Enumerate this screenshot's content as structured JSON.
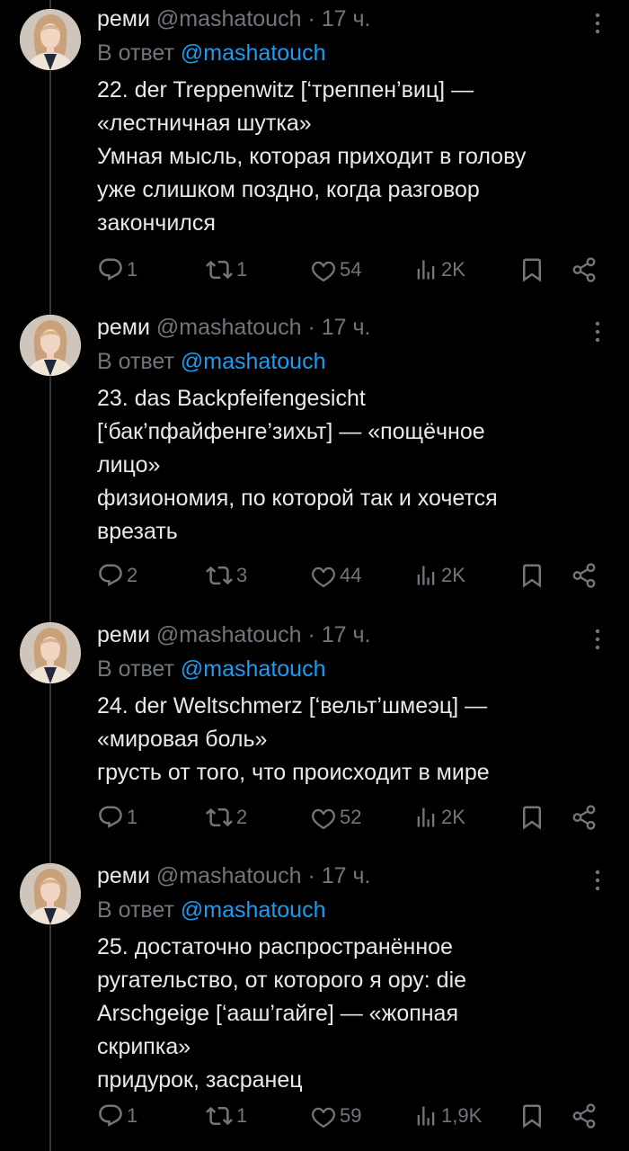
{
  "tweets": [
    {
      "display_name": "реми",
      "handle": "@mashatouch",
      "separator": "·",
      "time": "17 ч.",
      "reply_prefix": "В ответ",
      "reply_mention": "@mashatouch",
      "lines": [
        "22. der Treppenwitz [‘треппен’виц] —",
        "«лестничная шутка»",
        "Умная мысль, которая приходит в голову",
        "уже слишком поздно, когда разговор",
        "закончился"
      ],
      "replies": "1",
      "reposts": "1",
      "likes": "54",
      "views": "2K"
    },
    {
      "display_name": "реми",
      "handle": "@mashatouch",
      "separator": "·",
      "time": "17 ч.",
      "reply_prefix": "В ответ",
      "reply_mention": "@mashatouch",
      "lines": [
        "23. das Backpfeifengesicht",
        "[‘бак’пфайфенге’зихьт] — «пощёчное",
        "лицо»",
        "физиономия, по которой так и хочется",
        "врезать"
      ],
      "replies": "2",
      "reposts": "3",
      "likes": "44",
      "views": "2K"
    },
    {
      "display_name": "реми",
      "handle": "@mashatouch",
      "separator": "·",
      "time": "17 ч.",
      "reply_prefix": "В ответ",
      "reply_mention": "@mashatouch",
      "lines": [
        "24. der Weltschmerz [‘вельт’шмеэц] —",
        "«мировая боль»",
        "грусть от того, что происходит в мире"
      ],
      "replies": "1",
      "reposts": "2",
      "likes": "52",
      "views": "2K"
    },
    {
      "display_name": "реми",
      "handle": "@mashatouch",
      "separator": "·",
      "time": "17 ч.",
      "reply_prefix": "В ответ",
      "reply_mention": "@mashatouch",
      "lines": [
        "25. достаточно распространённое",
        "ругательство, от которого я ору: die",
        "Arschgeige [‘ааш’гайге] — «жопная",
        "скрипка»",
        "придурок, засранец"
      ],
      "replies": "1",
      "reposts": "1",
      "likes": "59",
      "views": "1,9K"
    }
  ],
  "icons": {
    "reply": "reply-icon",
    "repost": "repost-icon",
    "like": "heart-icon",
    "views": "views-icon",
    "bookmark": "bookmark-icon",
    "share": "share-icon",
    "more": "more-vertical-icon"
  },
  "colors": {
    "background": "#000000",
    "text": "#e7e9ea",
    "secondary": "#71767b",
    "link": "#1d9bf0",
    "thread_line": "#333639"
  }
}
